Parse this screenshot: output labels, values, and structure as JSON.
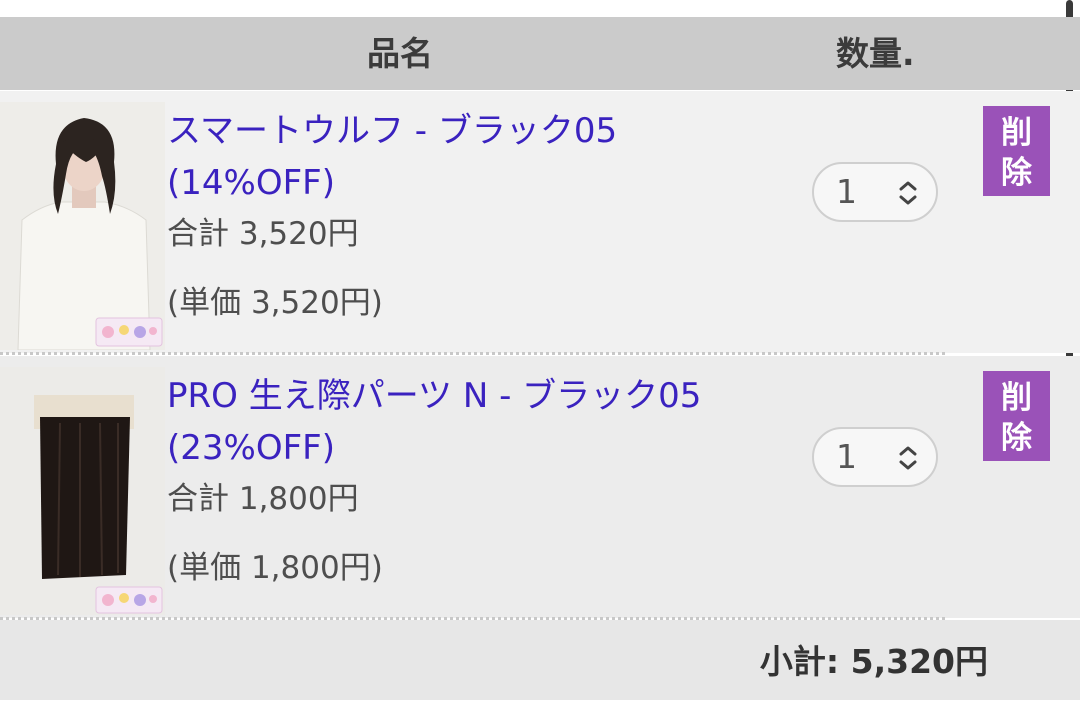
{
  "header": {
    "name_label": "品名",
    "qty_label": "数量."
  },
  "items": [
    {
      "title_line1": "スマートウルフ - ブラック05",
      "title_line2": "(14%OFF)",
      "total": "合計 3,520円",
      "unit_price": "(単価 3,520円)",
      "quantity": "1",
      "delete_label_1": "削",
      "delete_label_2": "除"
    },
    {
      "title_line1": "PRO 生え際パーツ N - ブラック05",
      "title_line2": "(23%OFF)",
      "total": "合計 1,800円",
      "unit_price": "(単価 1,800円)",
      "quantity": "1",
      "delete_label_1": "削",
      "delete_label_2": "除"
    }
  ],
  "footer": {
    "subtotal": "小計: 5,320円"
  },
  "colors": {
    "link": "#3a22bf",
    "delete_button": "#9a52b8",
    "header_bg": "#cbcbcb"
  },
  "icons": {
    "stepper": "chevron-up-down-icon"
  }
}
